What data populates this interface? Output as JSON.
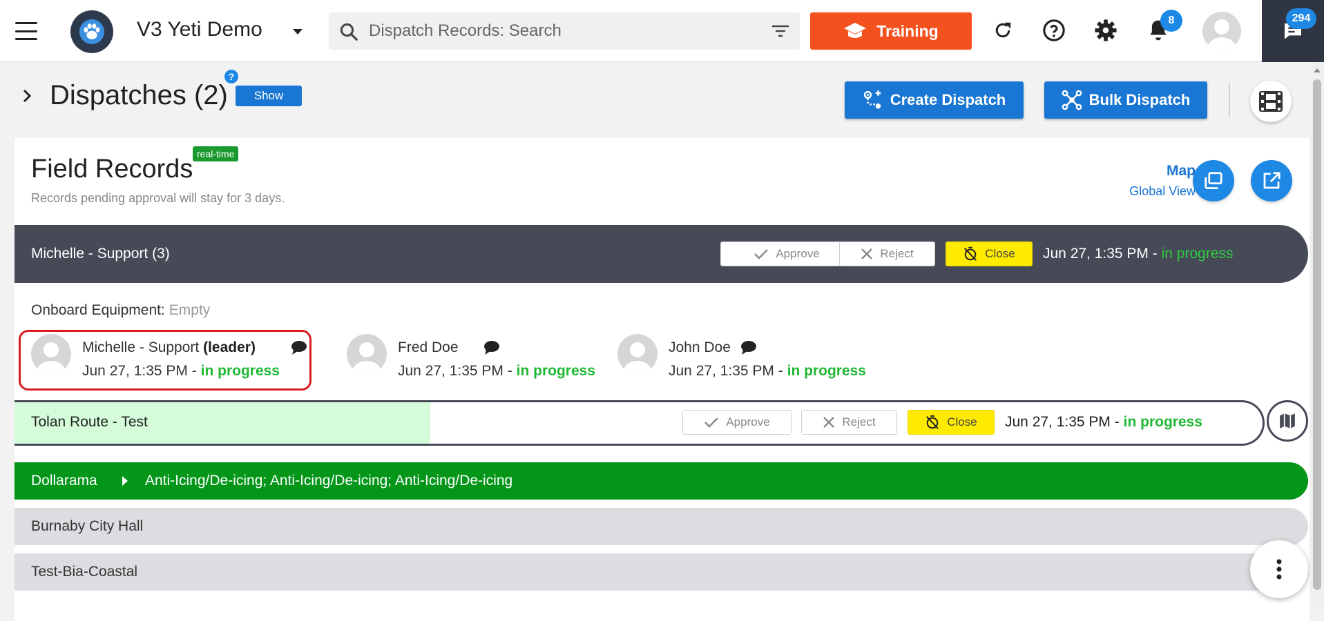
{
  "topbar": {
    "org_name": "V3 Yeti Demo",
    "search_placeholder": "Dispatch Records: Search",
    "training_label": "Training",
    "notification_count": "8",
    "chat_count": "294"
  },
  "page": {
    "title": "Dispatches (2)",
    "help": "?",
    "show_label": "Show",
    "create_label": "Create Dispatch",
    "bulk_label": "Bulk Dispatch"
  },
  "field_records": {
    "title": "Field Records",
    "badge": "real-time",
    "subtitle": "Records pending approval will stay for 3 days.",
    "map_label": "Map",
    "map_sub": "Global View"
  },
  "group": {
    "name": "Michelle - Support (3)",
    "approve": "Approve",
    "reject": "Reject",
    "close": "Close",
    "time": "Jun 27, 1:35 PM",
    "sep": "-",
    "status": "in progress"
  },
  "onboard": {
    "label": "Onboard Equipment:",
    "value": "Empty"
  },
  "members": [
    {
      "name": "Michelle - Support",
      "role": "(leader)",
      "time": "Jun 27, 1:35 PM",
      "sep": "-",
      "status": "in progress"
    },
    {
      "name": "Fred Doe",
      "role": "",
      "time": "Jun 27, 1:35 PM",
      "sep": "-",
      "status": "in progress"
    },
    {
      "name": "John Doe",
      "role": "",
      "time": "Jun 27, 1:35 PM",
      "sep": "-",
      "status": "in progress"
    }
  ],
  "route": {
    "name": "Tolan Route - Test",
    "approve": "Approve",
    "reject": "Reject",
    "close": "Close",
    "time": "Jun 27, 1:35 PM",
    "sep": "-",
    "status": "in progress"
  },
  "locations": [
    {
      "name": "Dollarama",
      "desc": "Anti-Icing/De-icing; Anti-Icing/De-icing; Anti-Icing/De-icing"
    },
    {
      "name": "Burnaby City Hall"
    },
    {
      "name": "Test-Bia-Coastal"
    }
  ],
  "colors": {
    "accent": "#1976d2",
    "training": "#f4511e",
    "progress": "#1fb832",
    "location_green": "#049619",
    "close_yellow": "#ffeb00"
  }
}
